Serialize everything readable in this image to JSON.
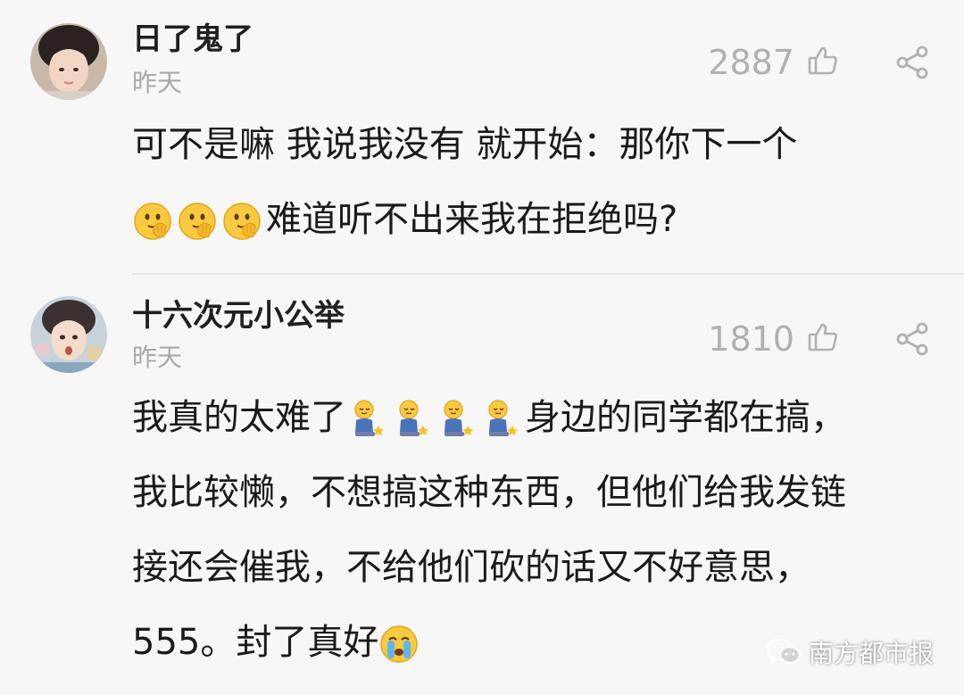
{
  "comments": [
    {
      "username": "日了鬼了",
      "time": "昨天",
      "likes": "2887",
      "text_line1": "可不是嘛 我说我没有 就开始：那你下一个",
      "text_line2": "难道听不出来我在拒绝吗?",
      "emoji": "thinking-face-emoji"
    },
    {
      "username": "十六次元小公举",
      "time": "昨天",
      "likes": "1810",
      "text_part1": "我真的太难了",
      "text_part2": "身边的同学都在搞，我比较懒，不想搞这种东西，但他们给我发链接还会催我，不给他们砍的话又不好意思，555。封了真好",
      "emoji": "kneeling-figure-emoji",
      "end_emoji": "crying-face-emoji"
    }
  ],
  "watermark": {
    "text": "南方都市报",
    "icon": "wechat-icon"
  },
  "colors": {
    "background": "#f7f7f7",
    "username": "#1f1f1f",
    "muted": "#a8a8a8",
    "body_text": "#1a1a1a"
  },
  "icons": {
    "like": "thumbs-up-icon",
    "share": "share-icon"
  }
}
